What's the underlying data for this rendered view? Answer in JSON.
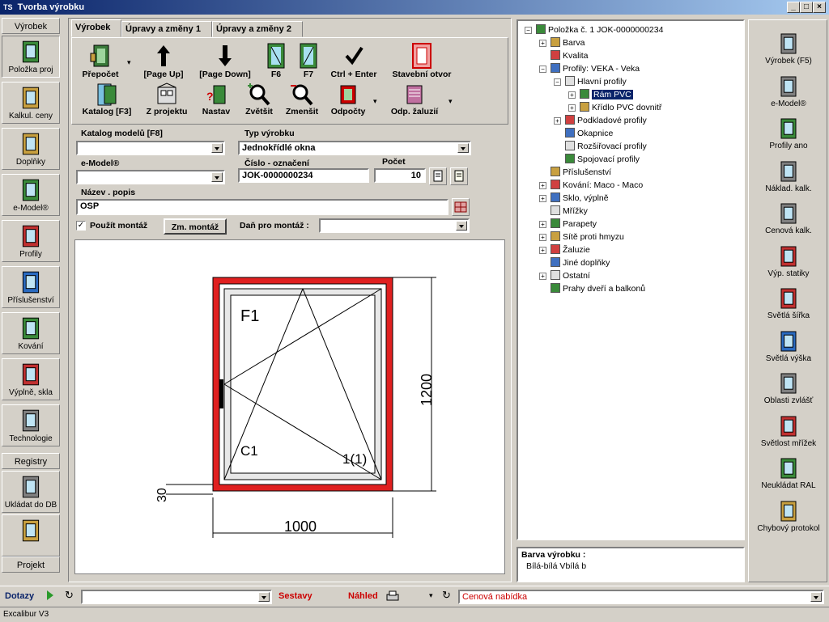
{
  "window": {
    "title": "Tvorba výrobku",
    "app_badge": "TS",
    "controls": {
      "minimize": "_",
      "maximize": "□",
      "close": "×"
    }
  },
  "left_sidebar": {
    "section1_header": "Výrobek",
    "items": [
      {
        "label": "Položka  proj",
        "icon": "window-item-icon"
      },
      {
        "label": "Kalkul. ceny",
        "icon": "door-icon"
      },
      {
        "label": "Doplňky",
        "icon": "monitor-icon"
      },
      {
        "label": "e-Model®",
        "icon": "emodel-icon"
      },
      {
        "label": "Profily",
        "icon": "profile-icon"
      },
      {
        "label": "Příslušenství",
        "icon": "accessories-icon"
      },
      {
        "label": "Kování",
        "icon": "handle-icon"
      },
      {
        "label": "Výplně, skla",
        "icon": "glass-icon"
      },
      {
        "label": "Technologie",
        "icon": "technology-icon"
      }
    ],
    "section2_header": "Registry",
    "items2": [
      {
        "label": "Ukládat do DB",
        "icon": "save-db-icon"
      },
      {
        "label": "",
        "icon": "database-icon"
      }
    ],
    "section3_header": "Projekt"
  },
  "tabs": [
    "Výrobek",
    "Úpravy a změny 1",
    "Úpravy a změny 2"
  ],
  "toolbar": {
    "row1": [
      {
        "label": "Přepočet",
        "icon": "recalc-icon"
      },
      {
        "label": "[Page Up]",
        "icon": "arrow-up-icon"
      },
      {
        "label": "[Page Down]",
        "icon": "arrow-down-icon"
      },
      {
        "label": "F6",
        "icon": "f6-icon"
      },
      {
        "label": "F7",
        "icon": "f7-icon"
      },
      {
        "label": "Ctrl + Enter",
        "icon": "check-icon"
      },
      {
        "label": "Stavební otvor",
        "icon": "opening-icon"
      }
    ],
    "row2": [
      {
        "label": "Katalog [F3]",
        "icon": "catalog-icon"
      },
      {
        "label": "Z projektu",
        "icon": "from-project-icon"
      },
      {
        "label": "Nastav",
        "icon": "set-icon"
      },
      {
        "label": "Zvětšit",
        "icon": "zoom-in-icon"
      },
      {
        "label": "Zmenšit",
        "icon": "zoom-out-icon"
      },
      {
        "label": "Odpočty",
        "icon": "deductions-icon"
      },
      {
        "label": "Odp. žaluzií",
        "icon": "blinds-icon"
      }
    ]
  },
  "form": {
    "catalog_label": "Katalog modelů [F8]",
    "catalog_value": "",
    "type_label": "Typ výrobku",
    "type_value": "Jednokřídlé okna",
    "emodel_label": "e-Model®",
    "emodel_value": "",
    "number_label": "Číslo - označení",
    "number_value": "JOK-0000000234",
    "count_label": "Počet",
    "count_value": "10",
    "name_label": "Název . popis",
    "name_value": "OSP",
    "use_mount_label": "Použít montáž",
    "change_mount_button": "Zm. montáž",
    "tax_label": "Daň pro montáž :",
    "tax_value": ""
  },
  "drawing": {
    "sash_label": "F1",
    "corner_label": "C1",
    "index_label": "1(1)",
    "height_dim": "1200",
    "width_dim": "1000",
    "sill_dim": "30",
    "frame_color": "#e02020"
  },
  "tree": {
    "nodes": [
      {
        "label": "Položka č. 1 JOK-0000000234",
        "level": 0,
        "exp": "-"
      },
      {
        "label": "Barva",
        "level": 1,
        "exp": "+"
      },
      {
        "label": "Kvalita",
        "level": 1,
        "exp": ""
      },
      {
        "label": "Profily: VEKA - Veka",
        "level": 1,
        "exp": "-"
      },
      {
        "label": "Hlavní profily",
        "level": 2,
        "exp": "-"
      },
      {
        "label": "Rám PVC",
        "level": 3,
        "exp": "+",
        "selected": true
      },
      {
        "label": "Křídlo PVC dovnitř",
        "level": 3,
        "exp": "+"
      },
      {
        "label": "Podkladové profily",
        "level": 2,
        "exp": "+"
      },
      {
        "label": "Okapnice",
        "level": 2,
        "exp": ""
      },
      {
        "label": "Rozšiřovací profily",
        "level": 2,
        "exp": ""
      },
      {
        "label": "Spojovací profily",
        "level": 2,
        "exp": ""
      },
      {
        "label": "Příslušenství",
        "level": 1,
        "exp": ""
      },
      {
        "label": "Kování: Maco - Maco",
        "level": 1,
        "exp": "+"
      },
      {
        "label": "Sklo, výplně",
        "level": 1,
        "exp": "+"
      },
      {
        "label": "Mřížky",
        "level": 1,
        "exp": ""
      },
      {
        "label": "Parapety",
        "level": 1,
        "exp": "+"
      },
      {
        "label": "Sítě proti hmyzu",
        "level": 1,
        "exp": "+"
      },
      {
        "label": "Žaluzie",
        "level": 1,
        "exp": "+"
      },
      {
        "label": "Jiné doplňky",
        "level": 1,
        "exp": ""
      },
      {
        "label": "Ostatní",
        "level": 1,
        "exp": "+"
      },
      {
        "label": "Prahy dveří a balkonů",
        "level": 1,
        "exp": ""
      }
    ],
    "info_title": "Barva výrobku :",
    "info_value": "Bílá-bílá  Vbílá b"
  },
  "right_sidebar": {
    "items": [
      {
        "label": "Výrobek (F5)",
        "icon": "product-icon"
      },
      {
        "label": "e-Model®",
        "icon": "emodel-window-icon"
      },
      {
        "label": "Profily ano",
        "icon": "profiles-yes-icon"
      },
      {
        "label": "Náklad. kalk.",
        "icon": "cost-calc-icon"
      },
      {
        "label": "Cenová kalk.",
        "icon": "price-calc-icon"
      },
      {
        "label": "Výp. statiky",
        "icon": "statics-icon"
      },
      {
        "label": "Světlá šířka",
        "icon": "clear-width-icon"
      },
      {
        "label": "Světlá výška",
        "icon": "clear-height-icon"
      },
      {
        "label": "Oblasti zvlášť",
        "icon": "areas-icon"
      },
      {
        "label": "Světlost mřížek",
        "icon": "grid-light-icon"
      },
      {
        "label": "Neukládat RAL",
        "icon": "no-ral-icon"
      },
      {
        "label": "Chybový protokol",
        "icon": "error-log-icon"
      }
    ]
  },
  "bottom_bar": {
    "queries_label": "Dotazy",
    "queries_value": "",
    "reports_label": "Sestavy",
    "preview_label": "Náhled",
    "report_value": "Cenová nabídka"
  },
  "status": {
    "text": "Excalibur V3"
  }
}
